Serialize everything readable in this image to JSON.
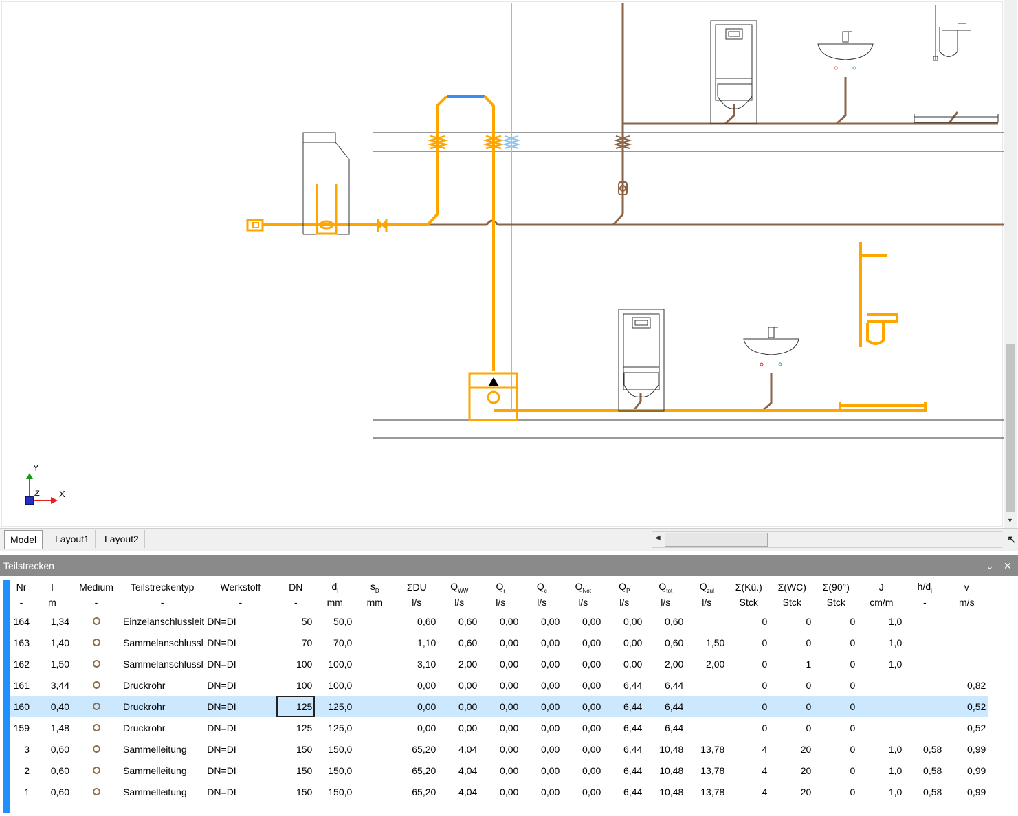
{
  "model_tabs": {
    "model": "Model",
    "layout1": "Layout1",
    "layout2": "Layout2"
  },
  "axis": {
    "y": "Y",
    "x": "X",
    "z": "Z"
  },
  "panel": {
    "title": "Teilstrecken"
  },
  "colors": {
    "orange": "#ffa500",
    "brown": "#8b6346",
    "blue": "#3c8df0",
    "lightblue": "#8cc2ee",
    "selected": "#cce8ff",
    "accent": "#1e90ff"
  },
  "columns": [
    {
      "name": "Nr",
      "sub": "",
      "unit": "-"
    },
    {
      "name": "l",
      "sub": "",
      "unit": "m"
    },
    {
      "name": "Medium",
      "sub": "",
      "unit": "-"
    },
    {
      "name": "Teilstreckentyp",
      "sub": "",
      "unit": "-"
    },
    {
      "name": "Werkstoff",
      "sub": "",
      "unit": "-"
    },
    {
      "name": "DN",
      "sub": "",
      "unit": "-"
    },
    {
      "name": "d",
      "sub": "i",
      "unit": "mm"
    },
    {
      "name": "s",
      "sub": "D",
      "unit": "mm"
    },
    {
      "name": "ΣDU",
      "sub": "",
      "unit": "l/s"
    },
    {
      "name": "Q",
      "sub": "WW",
      "unit": "l/s"
    },
    {
      "name": "Q",
      "sub": "r",
      "unit": "l/s"
    },
    {
      "name": "Q",
      "sub": "c",
      "unit": "l/s"
    },
    {
      "name": "Q",
      "sub": "Not",
      "unit": "l/s"
    },
    {
      "name": "Q",
      "sub": "P",
      "unit": "l/s"
    },
    {
      "name": "Q",
      "sub": "tot",
      "unit": "l/s"
    },
    {
      "name": "Q",
      "sub": "zul",
      "unit": "l/s"
    },
    {
      "name": "Σ(Kü.)",
      "sub": "",
      "unit": "Stck"
    },
    {
      "name": "Σ(WC)",
      "sub": "",
      "unit": "Stck"
    },
    {
      "name": "Σ(90°)",
      "sub": "",
      "unit": "Stck"
    },
    {
      "name": "J",
      "sub": "",
      "unit": "cm/m"
    },
    {
      "name": "h/d",
      "sub": "i",
      "unit": "-"
    },
    {
      "name": "v",
      "sub": "",
      "unit": "m/s"
    }
  ],
  "rows": [
    {
      "nr": "164",
      "l": "1,34",
      "typ": "Einzelanschlussleit",
      "werkstoff": "DN=DI",
      "dn": "50",
      "di": "50,0",
      "sd": "",
      "du": "0,60",
      "qww": "0,60",
      "qr": "0,00",
      "qc": "0,00",
      "qnot": "0,00",
      "qp": "0,00",
      "qtot": "0,60",
      "qzul": "",
      "ku": "0",
      "wc": "0",
      "w90": "0",
      "j": "1,0",
      "hdi": "",
      "v": ""
    },
    {
      "nr": "163",
      "l": "1,40",
      "typ": "Sammelanschlussl",
      "werkstoff": "DN=DI",
      "dn": "70",
      "di": "70,0",
      "sd": "",
      "du": "1,10",
      "qww": "0,60",
      "qr": "0,00",
      "qc": "0,00",
      "qnot": "0,00",
      "qp": "0,00",
      "qtot": "0,60",
      "qzul": "1,50",
      "ku": "0",
      "wc": "0",
      "w90": "0",
      "j": "1,0",
      "hdi": "",
      "v": ""
    },
    {
      "nr": "162",
      "l": "1,50",
      "typ": "Sammelanschlussl",
      "werkstoff": "DN=DI",
      "dn": "100",
      "di": "100,0",
      "sd": "",
      "du": "3,10",
      "qww": "2,00",
      "qr": "0,00",
      "qc": "0,00",
      "qnot": "0,00",
      "qp": "0,00",
      "qtot": "2,00",
      "qzul": "2,00",
      "ku": "0",
      "wc": "1",
      "w90": "0",
      "j": "1,0",
      "hdi": "",
      "v": ""
    },
    {
      "nr": "161",
      "l": "3,44",
      "typ": "Druckrohr",
      "werkstoff": "DN=DI",
      "dn": "100",
      "di": "100,0",
      "sd": "",
      "du": "0,00",
      "qww": "0,00",
      "qr": "0,00",
      "qc": "0,00",
      "qnot": "0,00",
      "qp": "6,44",
      "qtot": "6,44",
      "qzul": "",
      "ku": "0",
      "wc": "0",
      "w90": "0",
      "j": "",
      "hdi": "",
      "v": "0,82"
    },
    {
      "nr": "160",
      "l": "0,40",
      "typ": "Druckrohr",
      "werkstoff": "DN=DI",
      "dn": "125",
      "di": "125,0",
      "sd": "",
      "du": "0,00",
      "qww": "0,00",
      "qr": "0,00",
      "qc": "0,00",
      "qnot": "0,00",
      "qp": "6,44",
      "qtot": "6,44",
      "qzul": "",
      "ku": "0",
      "wc": "0",
      "w90": "0",
      "j": "",
      "hdi": "",
      "v": "0,52",
      "selected": true
    },
    {
      "nr": "159",
      "l": "1,48",
      "typ": "Druckrohr",
      "werkstoff": "DN=DI",
      "dn": "125",
      "di": "125,0",
      "sd": "",
      "du": "0,00",
      "qww": "0,00",
      "qr": "0,00",
      "qc": "0,00",
      "qnot": "0,00",
      "qp": "6,44",
      "qtot": "6,44",
      "qzul": "",
      "ku": "0",
      "wc": "0",
      "w90": "0",
      "j": "",
      "hdi": "",
      "v": "0,52"
    },
    {
      "nr": "3",
      "l": "0,60",
      "typ": "Sammelleitung",
      "werkstoff": "DN=DI",
      "dn": "150",
      "di": "150,0",
      "sd": "",
      "du": "65,20",
      "qww": "4,04",
      "qr": "0,00",
      "qc": "0,00",
      "qnot": "0,00",
      "qp": "6,44",
      "qtot": "10,48",
      "qzul": "13,78",
      "ku": "4",
      "wc": "20",
      "w90": "0",
      "j": "1,0",
      "hdi": "0,58",
      "v": "0,99"
    },
    {
      "nr": "2",
      "l": "0,60",
      "typ": "Sammelleitung",
      "werkstoff": "DN=DI",
      "dn": "150",
      "di": "150,0",
      "sd": "",
      "du": "65,20",
      "qww": "4,04",
      "qr": "0,00",
      "qc": "0,00",
      "qnot": "0,00",
      "qp": "6,44",
      "qtot": "10,48",
      "qzul": "13,78",
      "ku": "4",
      "wc": "20",
      "w90": "0",
      "j": "1,0",
      "hdi": "0,58",
      "v": "0,99"
    },
    {
      "nr": "1",
      "l": "0,60",
      "typ": "Sammelleitung",
      "werkstoff": "DN=DI",
      "dn": "150",
      "di": "150,0",
      "sd": "",
      "du": "65,20",
      "qww": "4,04",
      "qr": "0,00",
      "qc": "0,00",
      "qnot": "0,00",
      "qp": "6,44",
      "qtot": "10,48",
      "qzul": "13,78",
      "ku": "4",
      "wc": "20",
      "w90": "0",
      "j": "1,0",
      "hdi": "0,58",
      "v": "0,99"
    }
  ]
}
